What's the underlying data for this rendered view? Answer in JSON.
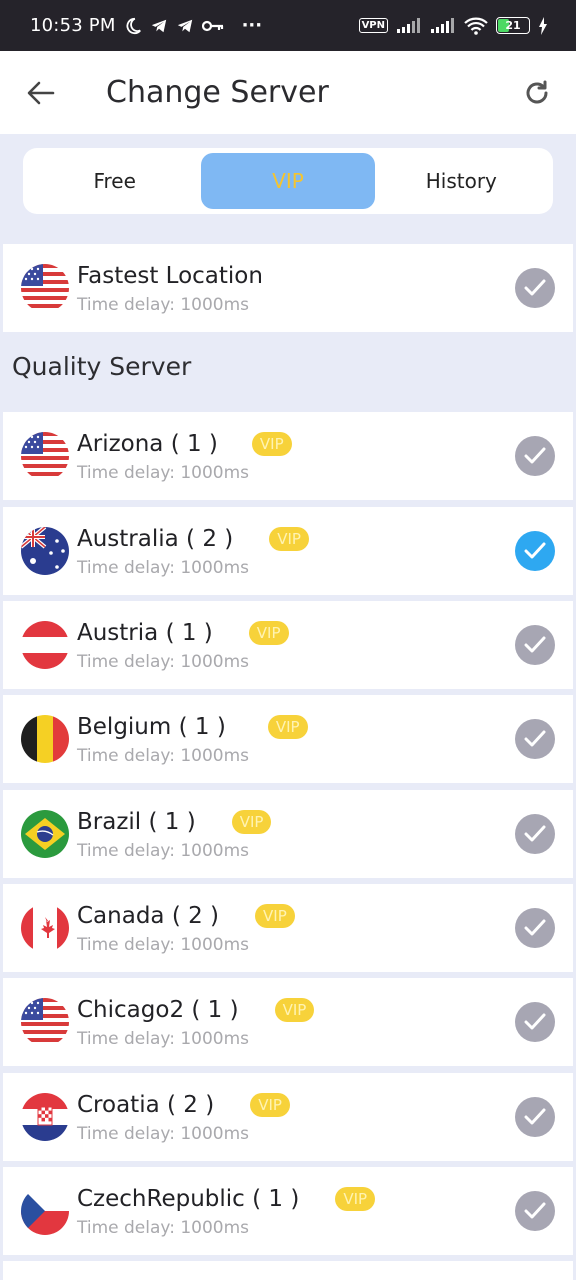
{
  "status_bar": {
    "time": "10:53 PM",
    "vpn": "VPN",
    "battery": "21",
    "more": "···"
  },
  "header": {
    "title": "Change Server"
  },
  "tabs": [
    {
      "label": "Free",
      "active": false
    },
    {
      "label": "VIP",
      "active": true
    },
    {
      "label": "History",
      "active": false
    }
  ],
  "fastest": {
    "name": "Fastest Location",
    "delay": "Time delay: 1000ms",
    "flag": "us"
  },
  "section_title": "Quality Server",
  "vip_label": "VIP",
  "servers": [
    {
      "name": "Arizona ( 1 )",
      "delay": "Time delay: 1000ms",
      "flag": "us",
      "selected": false
    },
    {
      "name": "Australia ( 2 )",
      "delay": "Time delay: 1000ms",
      "flag": "au",
      "selected": true
    },
    {
      "name": "Austria ( 1 )",
      "delay": "Time delay: 1000ms",
      "flag": "at",
      "selected": false
    },
    {
      "name": "Belgium ( 1 )",
      "delay": "Time delay: 1000ms",
      "flag": "be",
      "selected": false
    },
    {
      "name": "Brazil ( 1 )",
      "delay": "Time delay: 1000ms",
      "flag": "br",
      "selected": false
    },
    {
      "name": "Canada ( 2 )",
      "delay": "Time delay: 1000ms",
      "flag": "ca",
      "selected": false
    },
    {
      "name": "Chicago2 ( 1 )",
      "delay": "Time delay: 1000ms",
      "flag": "us",
      "selected": false
    },
    {
      "name": "Croatia ( 2 )",
      "delay": "Time delay: 1000ms",
      "flag": "hr",
      "selected": false
    },
    {
      "name": "CzechRepublic ( 1 )",
      "delay": "Time delay: 1000ms",
      "flag": "cz",
      "selected": false
    }
  ],
  "colors": {
    "accent": "#7fb8f3",
    "vip": "#f7d23a",
    "selected_check": "#2ea8f1",
    "check": "#a7a6b3"
  }
}
